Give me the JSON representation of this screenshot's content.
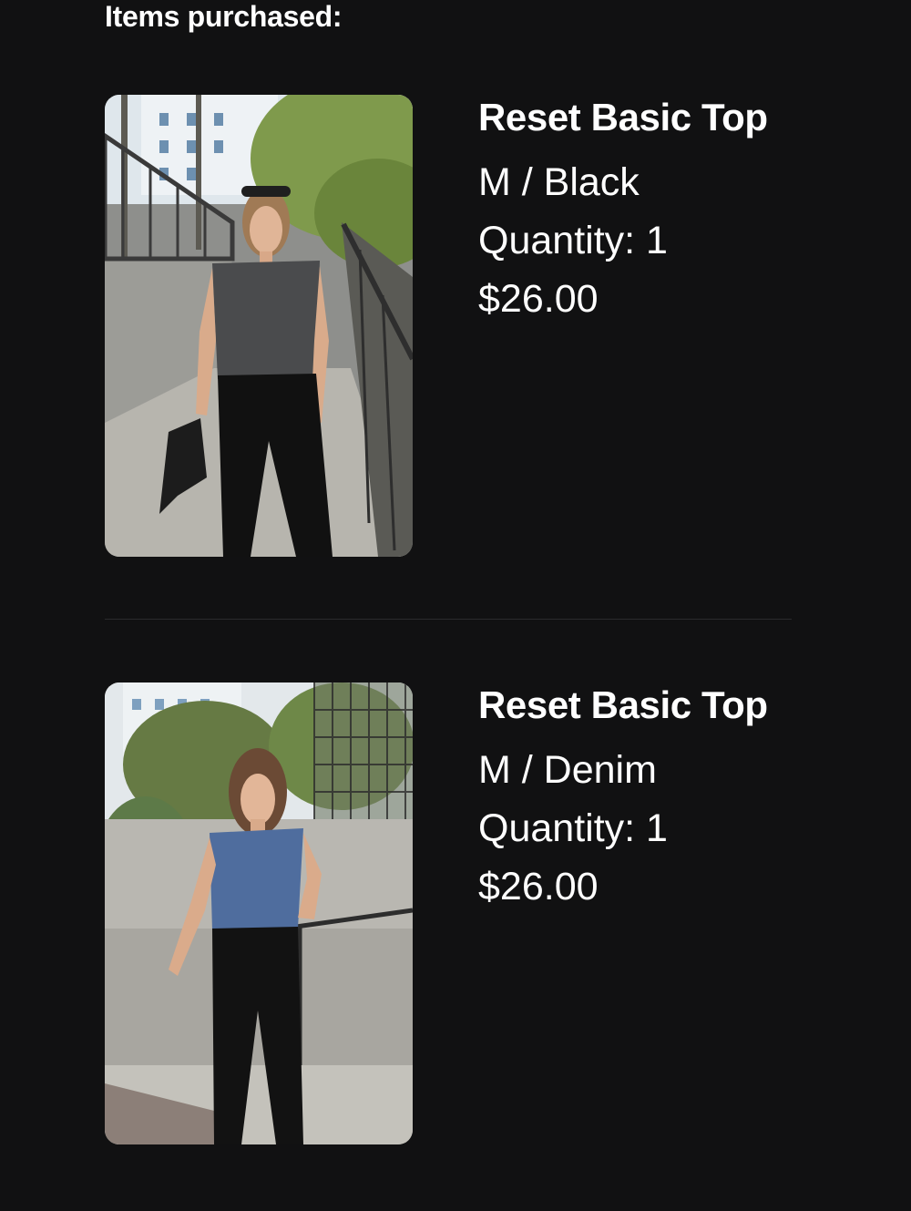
{
  "section": {
    "title": "Items purchased:"
  },
  "items": [
    {
      "name": "Reset Basic Top",
      "variant": "M / Black",
      "quantity": "Quantity: 1",
      "price": "$26.00",
      "image_icon": "product-photo-black-top"
    },
    {
      "name": "Reset Basic Top",
      "variant": "M / Denim",
      "quantity": "Quantity: 1",
      "price": "$26.00",
      "image_icon": "product-photo-denim-top"
    }
  ],
  "colors": {
    "background": "#111112",
    "text": "#ffffff",
    "divider": "#2b2b2d",
    "top_black": "#4a4b4d",
    "top_denim": "#4f6d9e"
  }
}
